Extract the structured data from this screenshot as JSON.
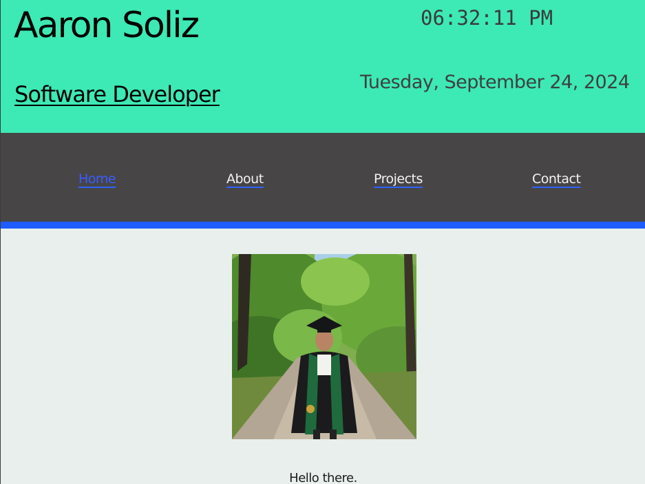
{
  "header": {
    "name": "Aaron Soliz",
    "role": "Software Developer",
    "clock": "06:32:11 PM",
    "date": "Tuesday, September 24, 2024",
    "background_color": "#3de9b4"
  },
  "nav": {
    "items": [
      {
        "label": "Home",
        "active": true
      },
      {
        "label": "About",
        "active": false
      },
      {
        "label": "Projects",
        "active": false
      },
      {
        "label": "Contact",
        "active": false
      }
    ],
    "background_color": "#474546",
    "accent_color": "#1f5cff"
  },
  "main": {
    "photo_icon": "graduation-portrait-photo",
    "greeting": "Hello there."
  }
}
